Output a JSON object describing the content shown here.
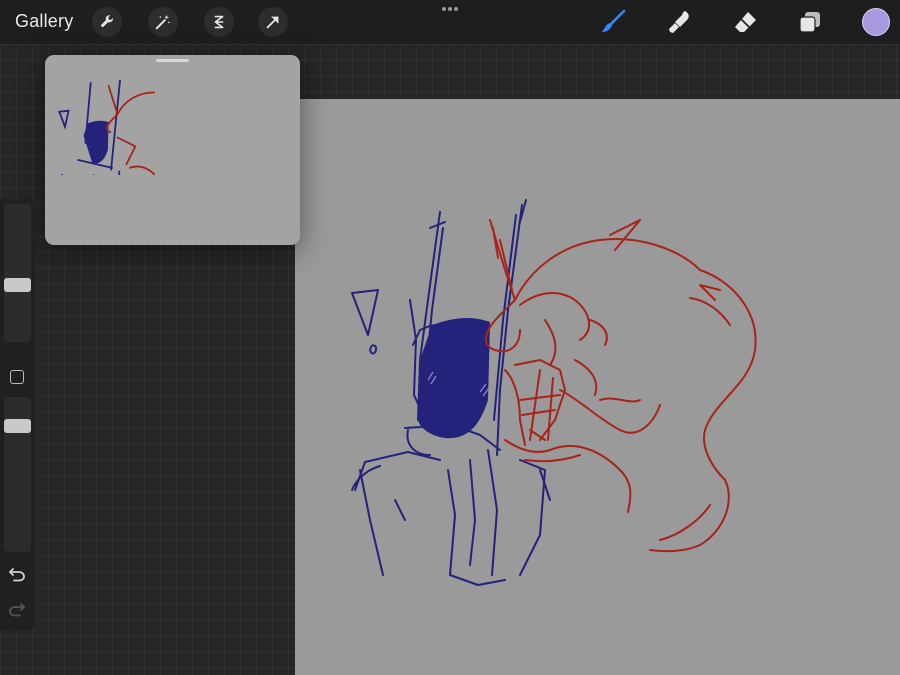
{
  "topbar": {
    "gallery_label": "Gallery",
    "left_tools": [
      "wrench-icon",
      "magic-wand-icon",
      "selection-icon",
      "transform-arrow-icon"
    ],
    "right_tools": [
      "brush-icon",
      "smudge-icon",
      "eraser-icon",
      "layers-icon"
    ],
    "active_tool": "brush",
    "active_tool_color": "#2f8cff",
    "current_color": "#a99ae0"
  },
  "reference_panel": {
    "title": ""
  },
  "sidebar": {
    "brush_size_level": 0.24,
    "opacity_level": 0.55,
    "icons": [
      "modify-square-icon",
      "undo-icon",
      "redo-icon"
    ]
  },
  "canvas": {
    "background": "#9a9a9a",
    "stroke_colors": [
      "#24227a",
      "#a8231a"
    ]
  }
}
